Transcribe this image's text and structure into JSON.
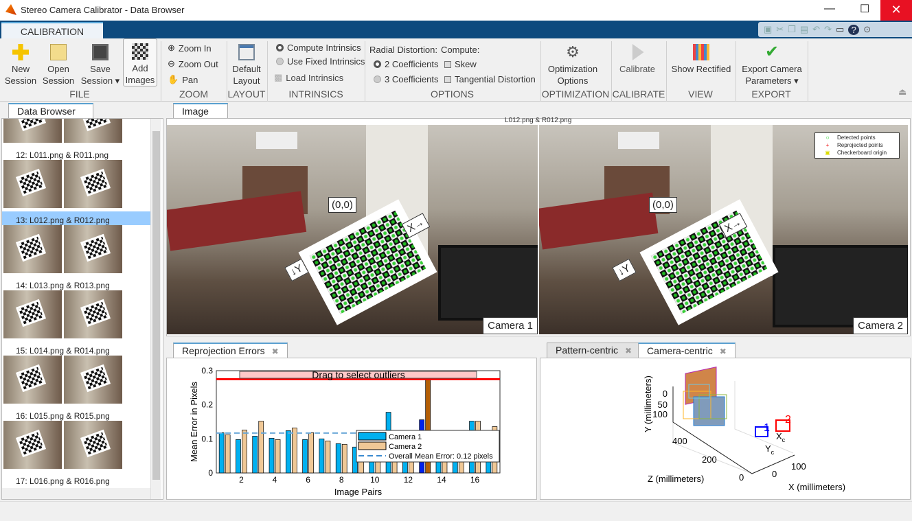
{
  "window": {
    "title": "Stereo Camera Calibrator - Data Browser"
  },
  "ribbon": {
    "tab": "CALIBRATION",
    "file": {
      "new": "New Session",
      "open": "Open Session",
      "save": "Save Session",
      "add": "Add Images",
      "label": "FILE"
    },
    "zoom": {
      "in": "Zoom In",
      "out": "Zoom Out",
      "pan": "Pan",
      "label": "ZOOM"
    },
    "layout": {
      "default": "Default Layout",
      "label": "LAYOUT"
    },
    "intrinsics": {
      "compute": "Compute Intrinsics",
      "fixed": "Use Fixed Intrinsics",
      "load": "Load Intrinsics",
      "label": "INTRINSICS"
    },
    "options": {
      "radial": "Radial Distortion:",
      "compute": "Compute:",
      "two": "2 Coefficients",
      "three": "3 Coefficients",
      "skew": "Skew",
      "tangential": "Tangential Distortion",
      "label": "OPTIONS"
    },
    "optimization": {
      "btn": "Optimization Options",
      "label": "OPTIMIZATION"
    },
    "calibrate": {
      "btn": "Calibrate",
      "label": "CALIBRATE"
    },
    "view": {
      "btn": "Show Rectified",
      "label": "VIEW"
    },
    "export": {
      "btn": "Export Camera Parameters",
      "label": "EXPORT"
    }
  },
  "browser": {
    "tab": "Data Browser",
    "items": [
      {
        "label": "12: L011.png & R011.png",
        "selected": false
      },
      {
        "label": "13: L012.png & R012.png",
        "selected": true
      },
      {
        "label": "14: L013.png & R013.png",
        "selected": false
      },
      {
        "label": "15: L014.png & R014.png",
        "selected": false
      },
      {
        "label": "16: L015.png & R015.png",
        "selected": false
      },
      {
        "label": "17: L016.png & R016.png",
        "selected": false
      }
    ]
  },
  "image": {
    "tab": "Image",
    "title": "L012.png & R012.png",
    "cam1": "Camera 1",
    "cam2": "Camera 2",
    "origin": "(0,0)",
    "xaxis": "X→",
    "yaxis": "↓Y",
    "legend": [
      "Detected points",
      "Reprojected points",
      "Checkerboard origin"
    ]
  },
  "reproj": {
    "tab": "Reprojection Errors"
  },
  "extr": {
    "tabs": [
      "Pattern-centric",
      "Camera-centric"
    ],
    "xlabel": "X (millimeters)",
    "ylabel": "Y (millimeters)",
    "zlabel": "Z (millimeters)",
    "xticks": [
      "0",
      "100"
    ],
    "yticks": [
      "0",
      "50",
      "100"
    ],
    "zticks": [
      "0",
      "200",
      "400"
    ],
    "cam1": "1",
    "cam2": "2",
    "xc": "X",
    "yc": "Y",
    "sub": "c"
  },
  "chart_data": {
    "type": "bar",
    "xlabel": "Image Pairs",
    "ylabel": "Mean Error in Pixels",
    "xlim": [
      0.5,
      17.5
    ],
    "ylim": [
      0,
      0.3
    ],
    "xticks": [
      "2",
      "4",
      "6",
      "8",
      "10",
      "12",
      "14",
      "16"
    ],
    "yticks": [
      "0",
      "0.1",
      "0.2",
      "0.3"
    ],
    "categories": [
      1,
      2,
      3,
      4,
      5,
      6,
      7,
      8,
      9,
      10,
      11,
      12,
      13,
      14,
      15,
      16,
      17
    ],
    "series": [
      {
        "name": "Camera 1",
        "color": "#00b0f0",
        "values": [
          0.118,
          0.098,
          0.108,
          0.102,
          0.124,
          0.098,
          0.1,
          0.086,
          0.076,
          0.09,
          0.178,
          0.09,
          0.156,
          0.09,
          0.09,
          0.152,
          0.09
        ]
      },
      {
        "name": "Camera 2",
        "color": "#f0c896",
        "values": [
          0.112,
          0.126,
          0.152,
          0.098,
          0.132,
          0.118,
          0.094,
          0.084,
          0.09,
          0.09,
          0.09,
          0.116,
          0.28,
          0.114,
          0.09,
          0.152,
          0.136
        ]
      }
    ],
    "mean_label": "Overall Mean Error: 0.12 pixels",
    "mean": 0.117,
    "threshold": 0.275,
    "outlier_label": "Drag to select outliers",
    "selected_pair": 13
  }
}
